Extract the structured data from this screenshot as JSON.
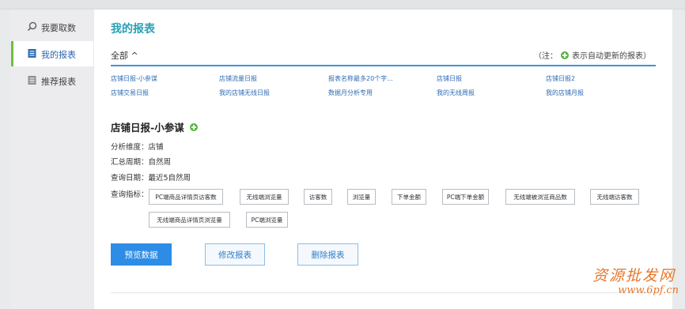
{
  "sidebar": {
    "items": [
      {
        "label": "我要取数",
        "icon": "search-icon",
        "active": false
      },
      {
        "label": "我的报表",
        "icon": "report-list-icon",
        "active": true
      },
      {
        "label": "推荐报表",
        "icon": "report-recommend-icon",
        "active": false
      }
    ]
  },
  "main": {
    "title": "我的报表",
    "filter": {
      "all_label": "全部 ^",
      "note_prefix": "（注：",
      "note_suffix": "表示自动更新的报表）"
    },
    "reports": [
      "店铺日报-小参谋",
      "店铺流量日报",
      "报表名称最多20个字...",
      "店铺日报",
      "店铺日报2",
      "店铺交易日报",
      "我的店铺无线日报",
      "数据月分析专用",
      "我的无线周报",
      "我的店铺月报"
    ],
    "detail": {
      "title": "店铺日报-小参谋",
      "dimension": "分析维度：店铺",
      "period": "汇总周期：自然周",
      "query_date": "查询日期：最近5自然周",
      "metrics_label": "查询指标：",
      "metrics": [
        "PC端商品详情页访客数",
        "无线端浏览量",
        "访客数",
        "浏览量",
        "下单金额",
        "PC端下单金额",
        "无线端被浏览商品数",
        "无线端访客数",
        "无线端商品详情页浏览量",
        "PC端浏览量"
      ]
    },
    "buttons": {
      "preview": "预览数据",
      "edit": "修改报表",
      "delete": "删除报表"
    }
  },
  "watermark": {
    "top": "资源批发网",
    "bottom": "www.6pf.cn"
  },
  "colors": {
    "accent": "#28a0b6",
    "link": "#2f6cb5",
    "primary_button": "#2c8ce6",
    "auto_update_dot": "#56b640",
    "active_indicator": "#6fbf3f",
    "watermark": "#e8762a"
  }
}
